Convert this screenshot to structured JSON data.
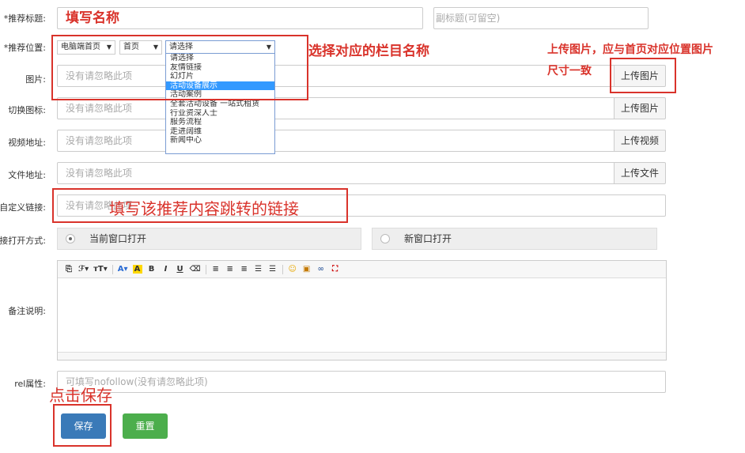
{
  "form": {
    "title_label": "*推荐标题:",
    "title_value": "填写名称",
    "subtitle_placeholder": "副标题(可留空)",
    "position_label": "*推荐位置:",
    "position_select1": "电脑端首页",
    "position_select2": "首页",
    "position_select3": "请选择",
    "dropdown_options": [
      "请选择",
      "友情链接",
      "幻灯片",
      "活动设备展示",
      "活动案例",
      "全套活动设备 一站式租赁",
      "行业资深人士",
      "服务流程",
      "走进阔维",
      "新闻中心"
    ],
    "dropdown_selected_index": 3,
    "image_label": "图片:",
    "image_placeholder": "没有请忽略此项",
    "image_upload": "上传图片",
    "switch_icon_label": "切换图标:",
    "switch_icon_placeholder": "没有请忽略此项",
    "switch_icon_upload": "上传图片",
    "video_label": "视频地址:",
    "video_placeholder": "没有请忽略此项",
    "video_upload": "上传视频",
    "file_label": "文件地址:",
    "file_placeholder": "没有请忽略此项",
    "file_upload": "上传文件",
    "link_label": "自定义链接:",
    "link_placeholder": "没有请忽略此项",
    "open_mode_label": "链接打开方式:",
    "open_current": "当前窗口打开",
    "open_new": "新窗口打开",
    "remark_label": "备注说明:",
    "rel_label": "rel属性:",
    "rel_placeholder": "可填写nofollow(没有请忽略此项)",
    "save_button": "保存",
    "reset_button": "重置"
  },
  "editor_toolbar": [
    "source-icon",
    "font-family-icon",
    "font-size-icon",
    "font-color-icon",
    "highlight-icon",
    "bold-icon",
    "italic-icon",
    "underline-icon",
    "clear-format-icon",
    "align-left-icon",
    "align-center-icon",
    "align-right-icon",
    "ordered-list-icon",
    "unordered-list-icon",
    "emoji-icon",
    "image-icon",
    "link-icon",
    "fullscreen-icon"
  ],
  "annotations": {
    "select_column": "选择对应的栏目名称",
    "upload_tip_line1": "上传图片，应与首页对应位置图片",
    "upload_tip_line2": "尺寸一致",
    "link_tip": "填写该推荐内容跳转的链接",
    "save_tip": "点击保存"
  },
  "colors": {
    "annotation_red": "#d9332b",
    "save_blue": "#3a7ab8",
    "reset_green": "#4cae4c",
    "highlight_blue": "#3399ff"
  }
}
